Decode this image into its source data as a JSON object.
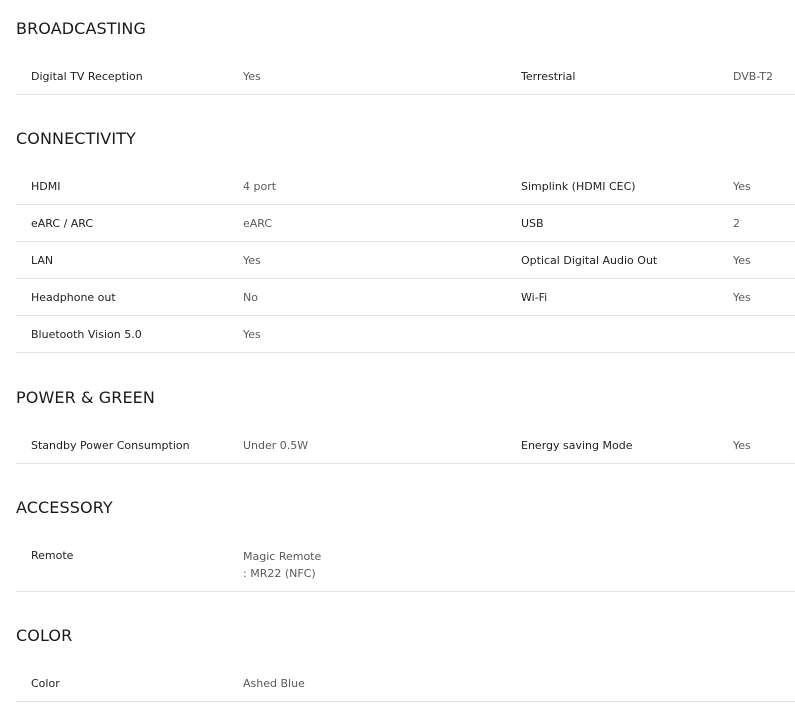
{
  "sections": [
    {
      "title": "BROADCASTING",
      "rows": [
        {
          "l1": "Digital TV Reception",
          "v1": "Yes",
          "l2": "Terrestrial",
          "v2": "DVB-T2"
        }
      ]
    },
    {
      "title": "CONNECTIVITY",
      "rows": [
        {
          "l1": "HDMI",
          "v1": "4 port",
          "l2": "Simplink (HDMI CEC)",
          "v2": "Yes"
        },
        {
          "l1": "eARC / ARC",
          "v1": "eARC",
          "l2": "USB",
          "v2": "2"
        },
        {
          "l1": "LAN",
          "v1": "Yes",
          "l2": "Optical Digital Audio Out",
          "v2": "Yes"
        },
        {
          "l1": "Headphone out",
          "v1": "No",
          "l2": "Wi-Fi",
          "v2": "Yes"
        },
        {
          "l1": "Bluetooth Vision 5.0",
          "v1": "Yes",
          "l2": "",
          "v2": ""
        }
      ]
    },
    {
      "title": "POWER & GREEN",
      "rows": [
        {
          "l1": "Standby Power Consumption",
          "v1": "Under 0.5W",
          "l2": "Energy saving Mode",
          "v2": "Yes"
        }
      ]
    },
    {
      "title": "ACCESSORY",
      "rows": [
        {
          "l1": "Remote",
          "v1_line1": "Magic Remote",
          "v1_line2": ": MR22 (NFC)"
        }
      ]
    },
    {
      "title": "COLOR",
      "rows": [
        {
          "l1": "Color",
          "v1": "Ashed Blue"
        }
      ]
    }
  ]
}
